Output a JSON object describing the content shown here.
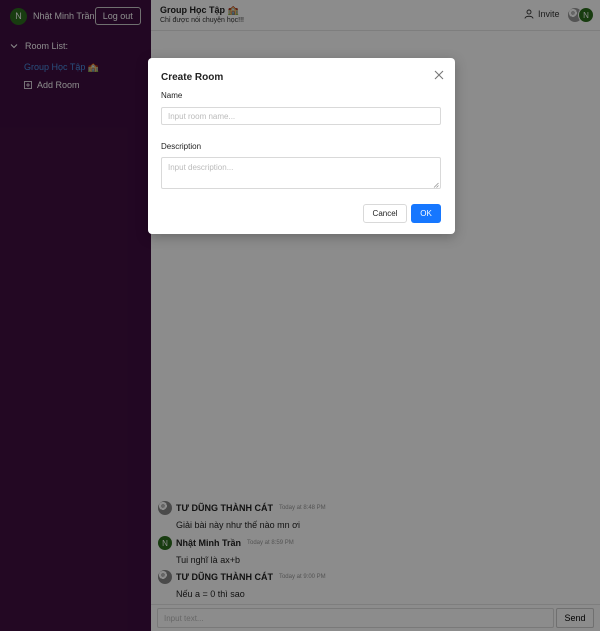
{
  "sidebar": {
    "user_avatar_letter": "N",
    "user_name": "Nhật Minh Trần",
    "logout_label": "Log out",
    "rooms_header": "Room List:",
    "rooms": [
      {
        "label": "Group Học Tập 🏫"
      }
    ],
    "add_room_label": "Add Room"
  },
  "header": {
    "title": "Group Học Tập 🏫",
    "description": "Chỉ được nói chuyện học!!!",
    "invite_label": "Invite",
    "member_avatar_letter": "N"
  },
  "messages": [
    {
      "author": "TƯ DŨNG THÀNH CÁT",
      "time": "Today at 8:48 PM",
      "text": "Giải bài này như thế nào mn ơi",
      "avatar": "pattern"
    },
    {
      "author": "Nhật Minh Trần",
      "time": "Today at 8:59 PM",
      "text": "Tui nghĩ là ax+b",
      "avatar": "N"
    },
    {
      "author": "TƯ DŨNG THÀNH CÁT",
      "time": "Today at 9:00 PM",
      "text": "Nếu a = 0 thì sao",
      "avatar": "pattern"
    }
  ],
  "composer": {
    "placeholder": "Input text...",
    "send_label": "Send"
  },
  "modal": {
    "title": "Create Room",
    "name_label": "Name",
    "name_placeholder": "Input room name...",
    "desc_label": "Description",
    "desc_placeholder": "Input description...",
    "cancel_label": "Cancel",
    "ok_label": "OK"
  },
  "colors": {
    "sidebar_bg": "#3f0e40",
    "accent": "#1677ff",
    "active_room": "#4a90e2",
    "avatar_green": "#2c6e1e"
  }
}
